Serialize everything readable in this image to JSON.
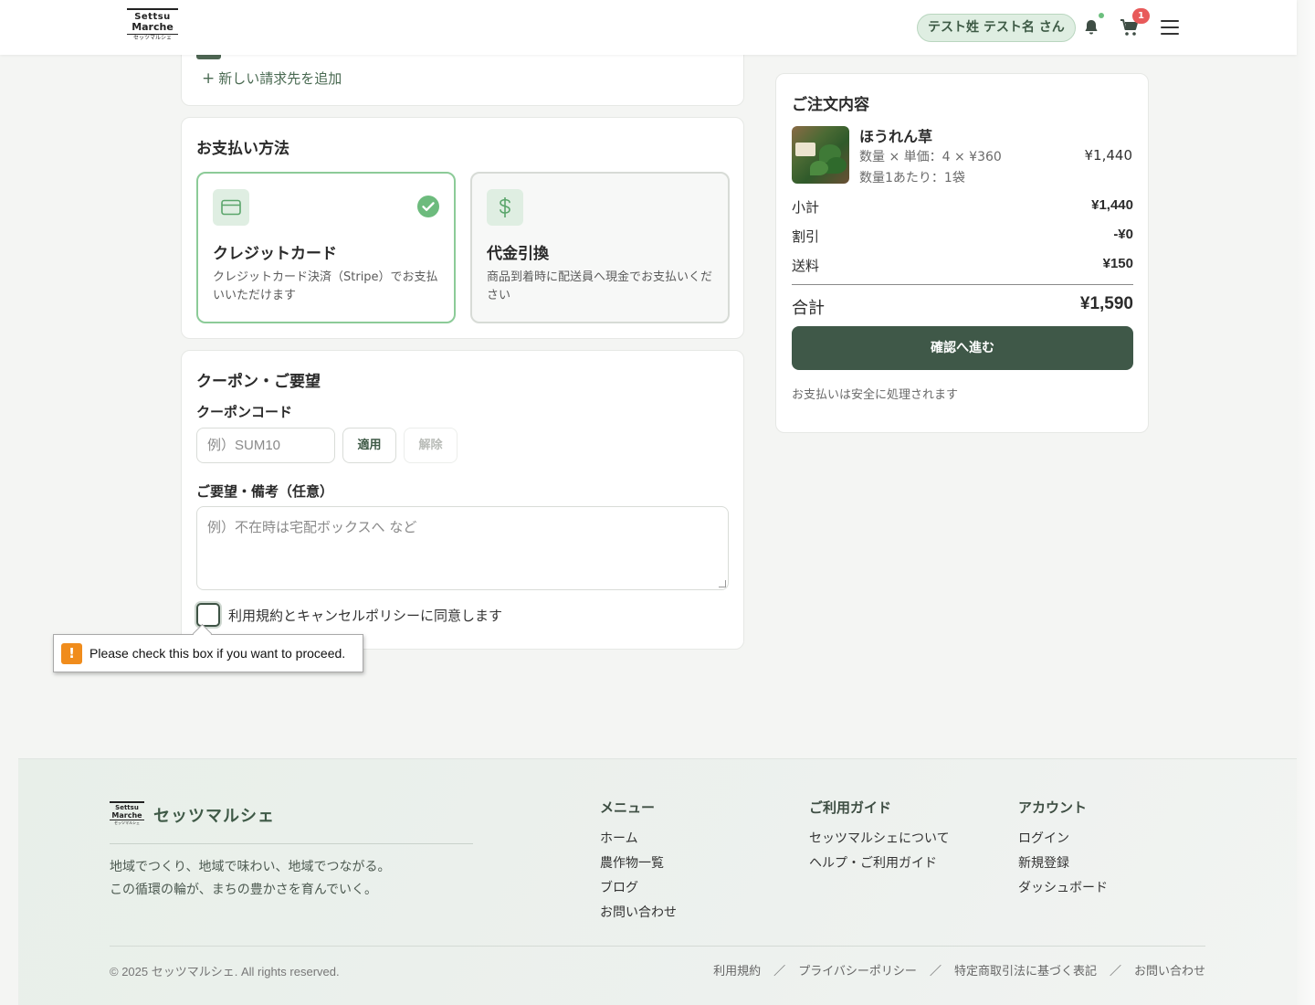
{
  "header": {
    "logo": {
      "line1": "Settsu",
      "line2": "Marche",
      "line3": "セッツマルシェ"
    },
    "user_greeting": "テスト姓 テスト名 さん",
    "cart_count": "1"
  },
  "billing": {
    "add_label": "新しい請求先を追加"
  },
  "payment": {
    "title": "お支払い方法",
    "options": [
      {
        "name": "クレジットカード",
        "desc": "クレジットカード決済（Stripe）でお支払いいただけます",
        "selected": true
      },
      {
        "name": "代金引換",
        "desc": "商品到着時に配送員へ現金でお支払いください",
        "selected": false
      }
    ]
  },
  "coupon": {
    "title": "クーポン・ご要望",
    "code_label": "クーポンコード",
    "placeholder": "例）SUM10",
    "apply_label": "適用",
    "clear_label": "解除",
    "notes_label": "ご要望・備考（任意）",
    "notes_placeholder": "例）不在時は宅配ボックスへ など",
    "agree_label": "利用規約とキャンセルポリシーに同意します"
  },
  "validation": {
    "message": "Please check this box if you want to proceed."
  },
  "summary": {
    "title": "ご注文内容",
    "item": {
      "name": "ほうれん草",
      "qty_line": "数量 × 単価：4 × ¥360",
      "unit_line": "数量1あたり：1袋",
      "price": "¥1,440"
    },
    "subtotal_label": "小計",
    "subtotal": "¥1,440",
    "discount_label": "割引",
    "discount": "-¥0",
    "shipping_label": "送料",
    "shipping": "¥150",
    "total_label": "合計",
    "total": "¥1,590",
    "confirm_label": "確認へ進む",
    "secure_note": "お支払いは安全に処理されます"
  },
  "footer": {
    "brand": "セッツマルシェ",
    "tagline1": "地域でつくり、地域で味わい、地域でつながる。",
    "tagline2": "この循環の輪が、まちの豊かさを育んでいく。",
    "menu_title": "メニュー",
    "menu": [
      "ホーム",
      "農作物一覧",
      "ブログ",
      "お問い合わせ"
    ],
    "guide_title": "ご利用ガイド",
    "guide": [
      "セッツマルシェについて",
      "ヘルプ・ご利用ガイド"
    ],
    "account_title": "アカウント",
    "account": [
      "ログイン",
      "新規登録",
      "ダッシュボード"
    ],
    "copyright": "© 2025 セッツマルシェ. All rights reserved.",
    "legal": [
      "利用規約",
      "プライバシーポリシー",
      "特定商取引法に基づく表記",
      "お問い合わせ"
    ],
    "legal_sep": "／"
  },
  "colors": {
    "accent": "#3f5848",
    "accent_light": "#dfeee2",
    "selected_border": "#8ccb98",
    "badge": "#e85a5a",
    "warning": "#f08c1c"
  }
}
